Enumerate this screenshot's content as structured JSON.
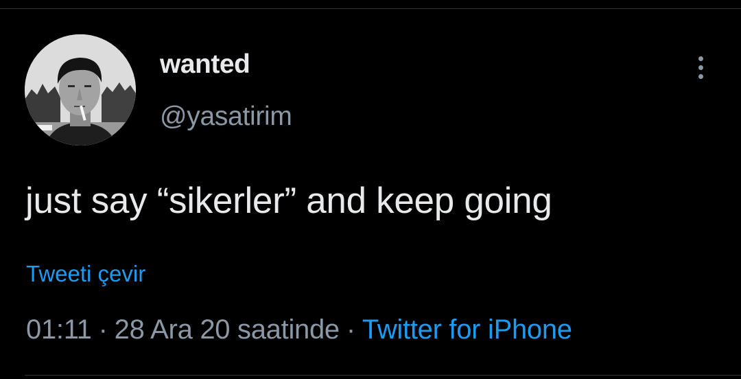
{
  "author": {
    "display_name": "wanted",
    "handle": "@yasatirim"
  },
  "tweet": {
    "text": "just say “sikerler” and keep going",
    "translate_label": "Tweeti çevir",
    "time": "01:11",
    "date": "28 Ara 20 saatinde",
    "separator": "·",
    "source": "Twitter for iPhone"
  },
  "icons": {
    "more": "more-vertical-icon"
  },
  "colors": {
    "background": "#000000",
    "primary_text": "#e7e9ea",
    "secondary_text": "#8b98a5",
    "link": "#1d9bf0",
    "divider": "#2f3336"
  }
}
